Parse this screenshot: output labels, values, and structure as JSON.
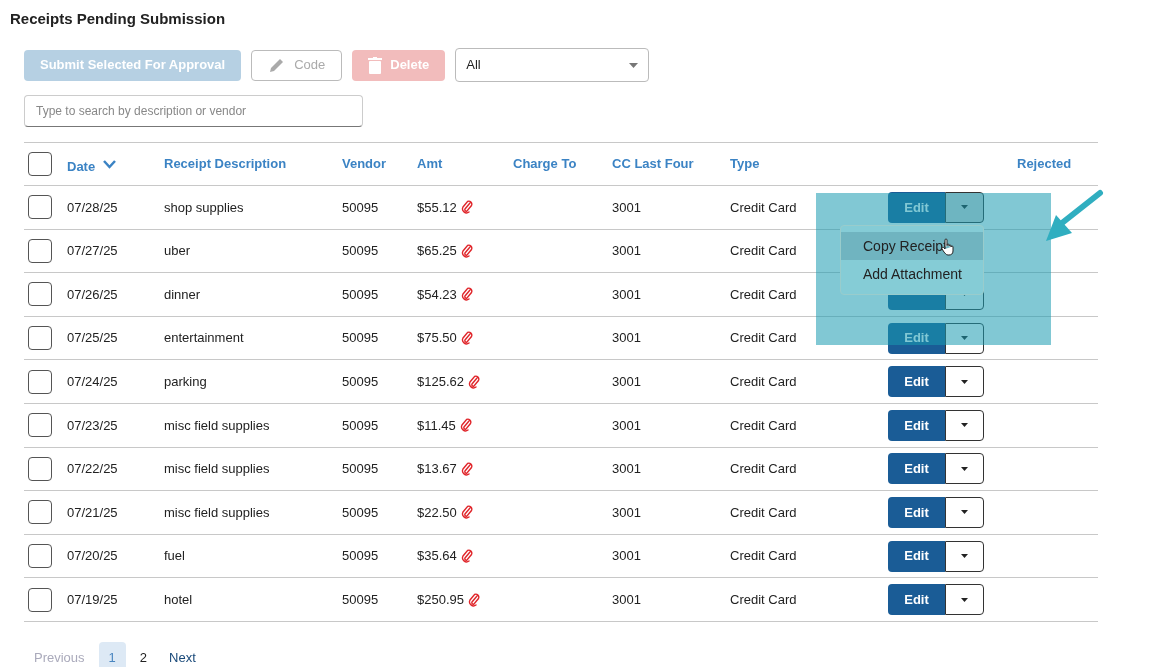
{
  "title": "Receipts Pending Submission",
  "toolbar": {
    "submit": {
      "label": "Submit Selected For Approval",
      "disabled": true
    },
    "code": {
      "label": "Code",
      "disabled": true
    },
    "delete": {
      "label": "Delete",
      "disabled": true
    },
    "filter": {
      "value": "All"
    }
  },
  "search": {
    "placeholder": "Type to search by description or vendor"
  },
  "table": {
    "select_all": {
      "checked": false
    },
    "columns": [
      "Date",
      "Receipt Description",
      "Vendor",
      "Amt",
      "Charge To",
      "CC Last Four",
      "Type",
      "Rejected"
    ],
    "rows": [
      {
        "checked": false,
        "date": "07/28/25",
        "description": "shop supplies",
        "vendor": "50095",
        "amt": "$55.12",
        "cc": "3001",
        "type": "Credit Card",
        "edit": "Edit",
        "menu_open": true
      },
      {
        "checked": false,
        "date": "07/27/25",
        "description": "uber",
        "vendor": "50095",
        "amt": "$65.25",
        "cc": "3001",
        "type": "Credit Card"
      },
      {
        "checked": false,
        "date": "07/26/25",
        "description": "dinner",
        "vendor": "50095",
        "amt": "$54.23",
        "cc": "3001",
        "type": "Credit Card",
        "menu_open": false
      },
      {
        "checked": false,
        "date": "07/25/25",
        "description": "entertainment",
        "vendor": "50095",
        "amt": "$75.50",
        "cc": "3001",
        "type": "Credit Card",
        "edit": "Edit",
        "menu_open": false
      },
      {
        "checked": false,
        "date": "07/24/25",
        "description": "parking",
        "vendor": "50095",
        "amt": "$125.62",
        "cc": "3001",
        "type": "Credit Card",
        "edit": "Edit",
        "menu_open": false
      },
      {
        "checked": false,
        "date": "07/23/25",
        "description": "misc field supplies",
        "vendor": "50095",
        "amt": "$11.45",
        "cc": "3001",
        "type": "Credit Card",
        "edit": "Edit",
        "menu_open": false
      },
      {
        "checked": false,
        "date": "07/22/25",
        "description": "misc field supplies",
        "vendor": "50095",
        "amt": "$13.67",
        "cc": "3001",
        "type": "Credit Card",
        "edit": "Edit",
        "menu_open": false
      },
      {
        "checked": false,
        "date": "07/21/25",
        "description": "misc field supplies",
        "vendor": "50095",
        "amt": "$22.50",
        "cc": "3001",
        "type": "Credit Card",
        "edit": "Edit",
        "menu_open": false
      },
      {
        "checked": false,
        "date": "07/20/25",
        "description": "fuel",
        "vendor": "50095",
        "amt": "$35.64",
        "cc": "3001",
        "type": "Credit Card",
        "edit": "Edit",
        "menu_open": false
      },
      {
        "checked": false,
        "date": "07/19/25",
        "description": "hotel",
        "vendor": "50095",
        "amt": "$250.95",
        "cc": "3001",
        "type": "Credit Card",
        "edit": "Edit",
        "menu_open": false
      }
    ]
  },
  "row_menu": {
    "items": [
      {
        "label": "Copy Receipt",
        "selected": true
      },
      {
        "label": "Add Attachment",
        "selected": false
      }
    ]
  },
  "pagination": {
    "previous": {
      "label": "Previous",
      "disabled": true
    },
    "pages": [
      {
        "label": "1",
        "selected": true
      },
      {
        "label": "2",
        "selected": false
      }
    ],
    "next": {
      "label": "Next",
      "disabled": false
    }
  }
}
